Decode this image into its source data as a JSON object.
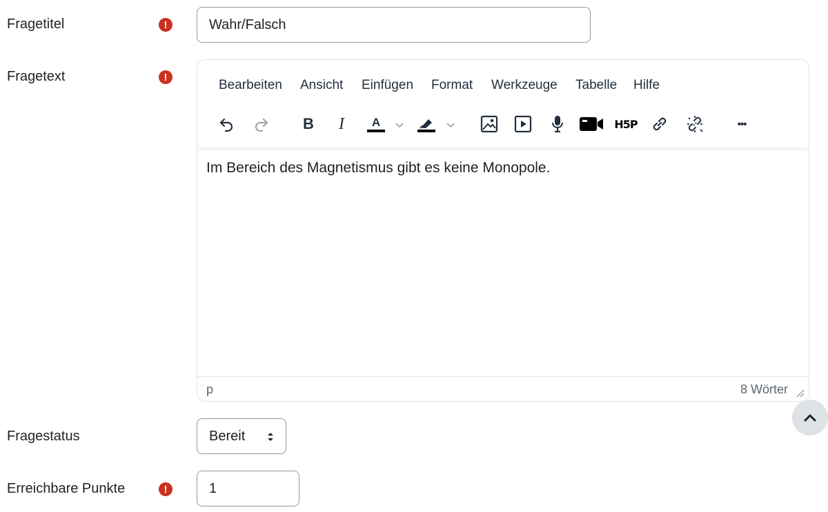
{
  "fields": {
    "title": {
      "label": "Fragetitel",
      "value": "Wahr/Falsch",
      "required_icon": "exclamation-circle-icon"
    },
    "text": {
      "label": "Fragetext",
      "required_icon": "exclamation-circle-icon"
    },
    "status": {
      "label": "Fragestatus",
      "selected": "Bereit"
    },
    "points": {
      "label": "Erreichbare Punkte",
      "value": "1",
      "required_icon": "exclamation-circle-icon"
    }
  },
  "editor": {
    "menu": [
      "Bearbeiten",
      "Ansicht",
      "Einfügen",
      "Format",
      "Werkzeuge",
      "Tabelle",
      "Hilfe"
    ],
    "content": "Im Bereich des Magnetismus gibt es keine Monopole.",
    "path": "p",
    "word_count": "8 Wörter",
    "toolbar_glyphs": {
      "bold": "B",
      "italic": "I",
      "text_color": "A",
      "h5p": "H5P",
      "more": "•••"
    }
  },
  "colors": {
    "required": "#ca3120",
    "border": "#8f959e",
    "text": "#1d2125"
  }
}
